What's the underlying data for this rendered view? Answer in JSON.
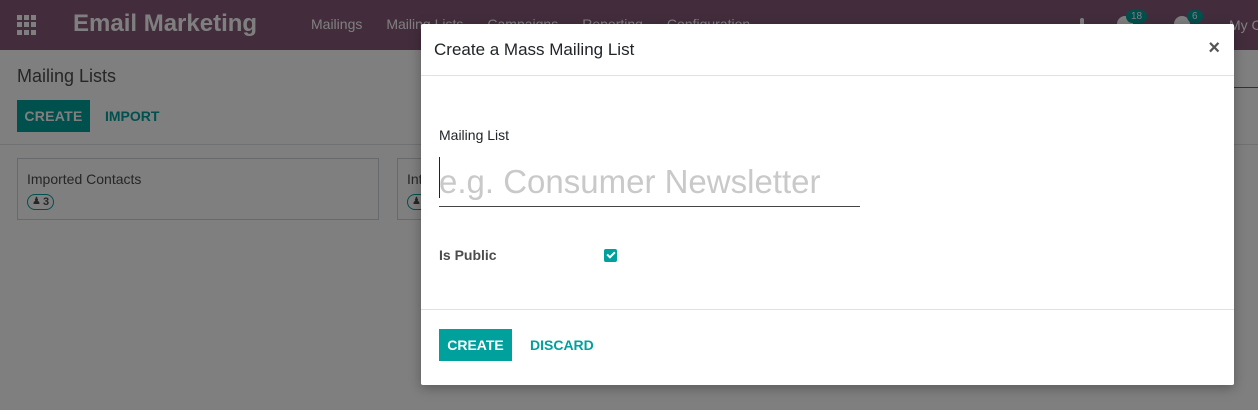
{
  "navbar": {
    "app_title": "Email Marketing",
    "menu": [
      "Mailings",
      "Mailing Lists",
      "Campaigns",
      "Reporting",
      "Configuration"
    ],
    "activity_badge": "18",
    "messages_badge": "6",
    "user": "My C"
  },
  "control_panel": {
    "title": "Mailing Lists",
    "create_label": "CREATE",
    "import_label": "IMPORT"
  },
  "kanban": [
    {
      "title": "Imported Contacts",
      "count": "3"
    },
    {
      "title": "Int",
      "count": ""
    }
  ],
  "modal": {
    "title": "Create a Mass Mailing List",
    "close_symbol": "×",
    "field_label": "Mailing List",
    "field_placeholder": "e.g. Consumer Newsletter",
    "field_value": "",
    "public_label": "Is Public",
    "public_checked": true,
    "create_label": "CREATE",
    "discard_label": "DISCARD"
  },
  "colors": {
    "navbar": "#875a7b",
    "accent": "#00a09d"
  }
}
